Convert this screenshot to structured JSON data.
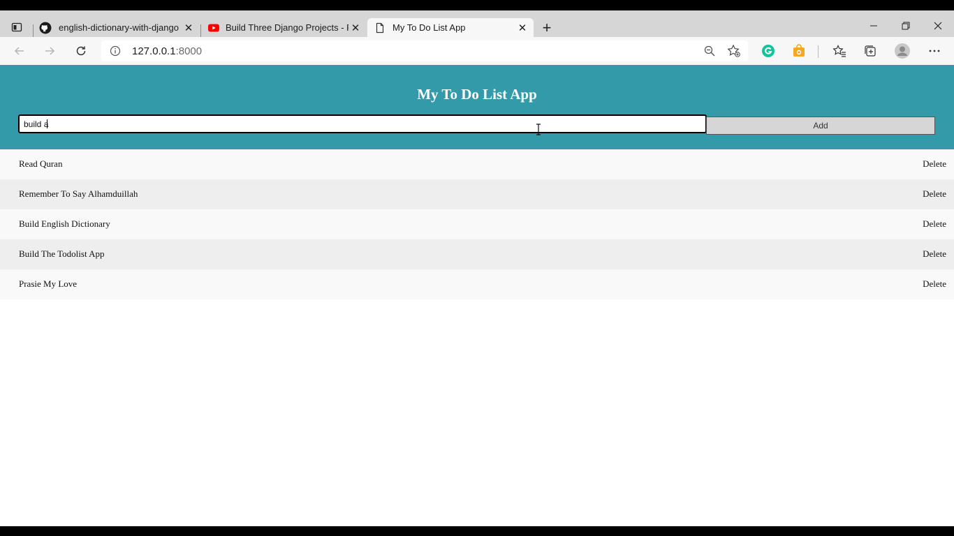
{
  "browser": {
    "tabs": [
      {
        "title": "english-dictionary-with-django/s",
        "icon": "github-icon"
      },
      {
        "title": "Build Three Django Projects - Pyt",
        "icon": "youtube-icon"
      },
      {
        "title": "My To Do List App",
        "icon": "page-icon"
      }
    ],
    "close_glyph": "✕",
    "new_tab_glyph": "+",
    "url_host": "127.0.0.1",
    "url_port": ":8000"
  },
  "app": {
    "title": "My To Do List App",
    "input_value": "build a",
    "add_label": "Add",
    "header_color": "#339aa9",
    "todos": [
      {
        "text": "Read Quran",
        "action": "Delete"
      },
      {
        "text": "Remember To Say Alhamduillah",
        "action": "Delete"
      },
      {
        "text": "Build English Dictionary",
        "action": "Delete"
      },
      {
        "text": "Build The Todolist App",
        "action": "Delete"
      },
      {
        "text": "Prasie My Love",
        "action": "Delete"
      }
    ]
  }
}
